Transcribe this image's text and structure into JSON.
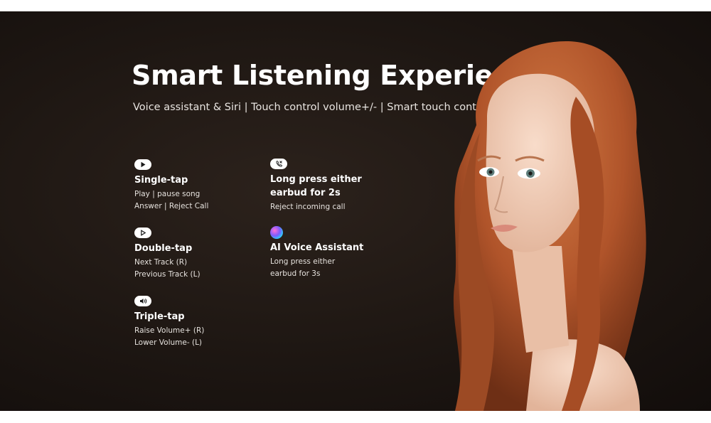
{
  "banner": {
    "title": "Smart Listening Experience",
    "subtitle": "Voice assistant & Siri | Touch control volume+/- | Smart touch control"
  },
  "features": [
    {
      "icon": "play-icon",
      "title": "Single-tap",
      "lines": [
        "Play | pause song",
        "Answer | Reject Call"
      ]
    },
    {
      "icon": "play-outline-icon",
      "title": "Double-tap",
      "lines": [
        "Next Track (R)",
        "Previous Track (L)"
      ]
    },
    {
      "icon": "volume-icon",
      "title": "Triple-tap",
      "lines": [
        "Raise Volume+ (R)",
        "Lower Volume- (L)"
      ]
    },
    {
      "icon": "phone-icon",
      "title_lines": [
        "Long press either",
        "earbud for 2s"
      ],
      "lines": [
        "Reject incoming call"
      ]
    },
    {
      "icon": "siri-icon",
      "title": "AI Voice Assistant",
      "lines": [
        "Long press either",
        "earbud for 3s"
      ]
    }
  ],
  "colors": {
    "background": "#1d1612",
    "text": "#ffffff",
    "hair": "#b5582a",
    "skin": "#f1cdb8"
  }
}
